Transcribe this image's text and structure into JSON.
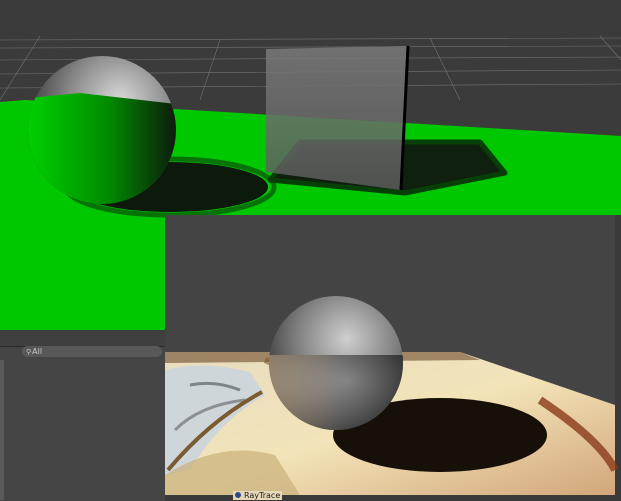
{
  "search": {
    "label": "All",
    "icon": "search-icon"
  },
  "object_label": {
    "text": "RayTrace",
    "icon": "unity-object-icon"
  },
  "colors": {
    "ground": "#00cc00",
    "background": "#3a3a3a",
    "sky": "#6a6a6a"
  }
}
